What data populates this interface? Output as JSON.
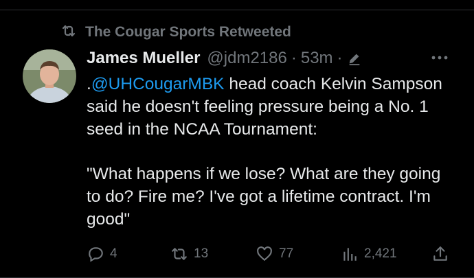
{
  "retweet": {
    "text": "The Cougar Sports Retweeted",
    "icon": "retweet-icon"
  },
  "tweet": {
    "author_name": "James Mueller",
    "handle": "@jdm2186",
    "separator1": "·",
    "time": "53m",
    "separator2": "·",
    "text_prefix": ".",
    "mention": "@UHCougarMBK",
    "text_line1": " head coach Kelvin Sampson said he doesn't feeling pressure being a No. 1 seed in the NCAA Tournament:",
    "quote": "\"What happens if we lose? What are they going to do? Fire me? I've got a lifetime contract. I'm good\""
  },
  "actions": {
    "replies": "4",
    "retweets": "13",
    "likes": "77",
    "views": "2,421"
  },
  "colors": {
    "background": "#000000",
    "text": "#e7e9ea",
    "muted": "#71767b",
    "link": "#1d9bf0"
  }
}
